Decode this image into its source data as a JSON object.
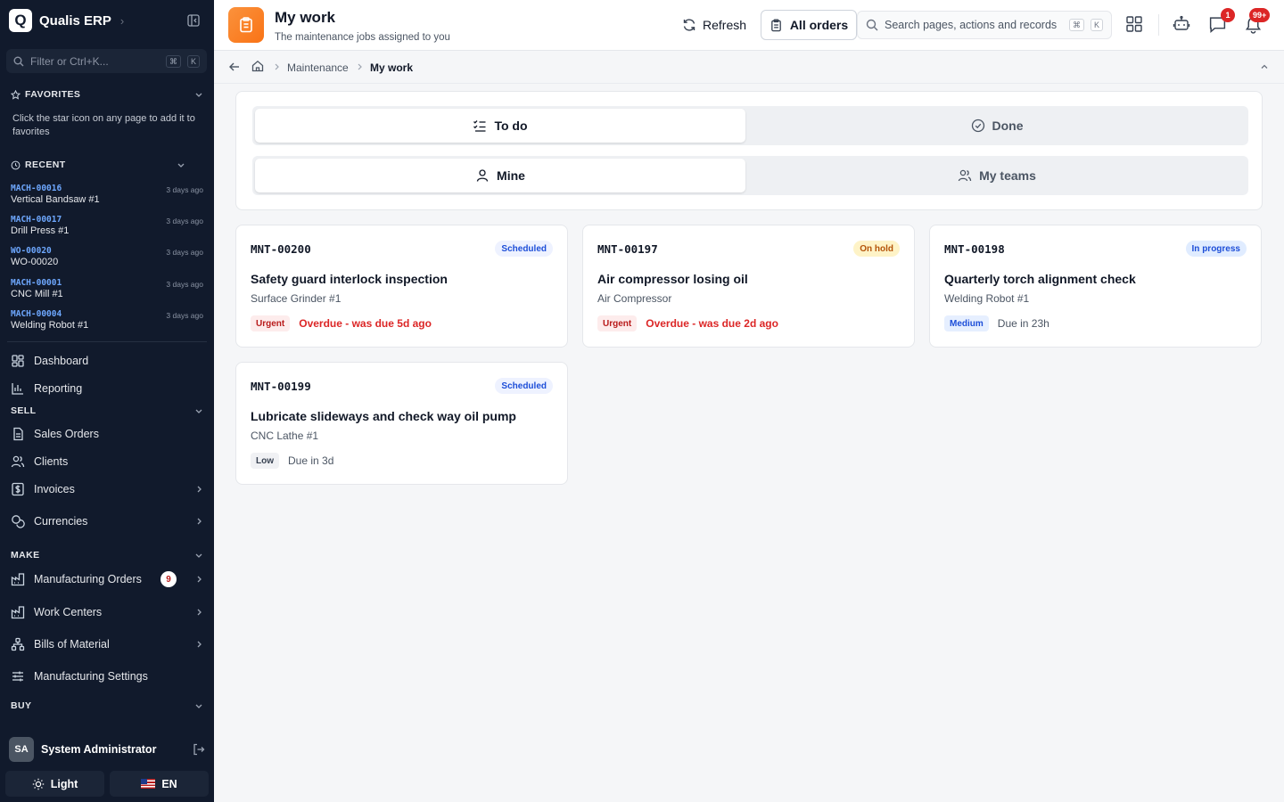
{
  "app": {
    "logo_letter": "Q",
    "name": "Qualis ERP"
  },
  "sidebar": {
    "filter_placeholder": "Filter or Ctrl+K...",
    "kbd_cmd": "⌘",
    "kbd_k": "K",
    "favorites_title": "FAVORITES",
    "favorites_hint": "Click the star icon on any page to add it to favorites",
    "recent_title": "RECENT",
    "recent": [
      {
        "id": "MACH-00016",
        "name": "Vertical Bandsaw #1",
        "time": "3 days ago"
      },
      {
        "id": "MACH-00017",
        "name": "Drill Press #1",
        "time": "3 days ago"
      },
      {
        "id": "WO-00020",
        "name": "WO-00020",
        "time": "3 days ago"
      },
      {
        "id": "MACH-00001",
        "name": "CNC Mill #1",
        "time": "3 days ago"
      },
      {
        "id": "MACH-00004",
        "name": "Welding Robot #1",
        "time": "3 days ago"
      }
    ],
    "nav": {
      "dashboard": "Dashboard",
      "reporting": "Reporting",
      "sell_title": "SELL",
      "sales_orders": "Sales Orders",
      "clients": "Clients",
      "invoices": "Invoices",
      "currencies": "Currencies",
      "make_title": "MAKE",
      "manufacturing_orders": "Manufacturing Orders",
      "manufacturing_orders_badge": "9",
      "work_centers": "Work Centers",
      "bills_of_material": "Bills of Material",
      "manufacturing_settings": "Manufacturing Settings",
      "buy_title": "BUY"
    },
    "user": {
      "initials": "SA",
      "name": "System Administrator"
    },
    "theme_label": "Light",
    "language_label": "EN"
  },
  "header": {
    "title": "My work",
    "subtitle": "The maintenance jobs assigned to you",
    "refresh_label": "Refresh",
    "all_orders_label": "All orders",
    "search_placeholder": "Search pages, actions and records",
    "kbd_cmd": "⌘",
    "kbd_k": "K",
    "messages_badge": "1",
    "notifications_badge": "99+"
  },
  "breadcrumb": {
    "section": "Maintenance",
    "current": "My work"
  },
  "filters": {
    "status_tabs": [
      {
        "label": "To do",
        "active": true
      },
      {
        "label": "Done",
        "active": false
      }
    ],
    "scope_tabs": [
      {
        "label": "Mine",
        "active": true
      },
      {
        "label": "My teams",
        "active": false
      }
    ]
  },
  "jobs": [
    {
      "id": "MNT-00200",
      "status": "Scheduled",
      "title": "Safety guard interlock inspection",
      "asset": "Surface Grinder #1",
      "priority": "Urgent",
      "due": "Overdue - was due 5d ago",
      "overdue": true
    },
    {
      "id": "MNT-00197",
      "status": "On hold",
      "title": "Air compressor losing oil",
      "asset": "Air Compressor",
      "priority": "Urgent",
      "due": "Overdue - was due 2d ago",
      "overdue": true
    },
    {
      "id": "MNT-00198",
      "status": "In progress",
      "title": "Quarterly torch alignment check",
      "asset": "Welding Robot #1",
      "priority": "Medium",
      "due": "Due in 23h",
      "overdue": false
    },
    {
      "id": "MNT-00199",
      "status": "Scheduled",
      "title": "Lubricate slideways and check way oil pump",
      "asset": "CNC Lathe #1",
      "priority": "Low",
      "due": "Due in 3d",
      "overdue": false
    }
  ],
  "colors": {
    "sidebar_bg": "#111a2c",
    "accent_orange": "#f97316",
    "overdue_red": "#dc2626",
    "link_blue": "#6ea8ff"
  }
}
